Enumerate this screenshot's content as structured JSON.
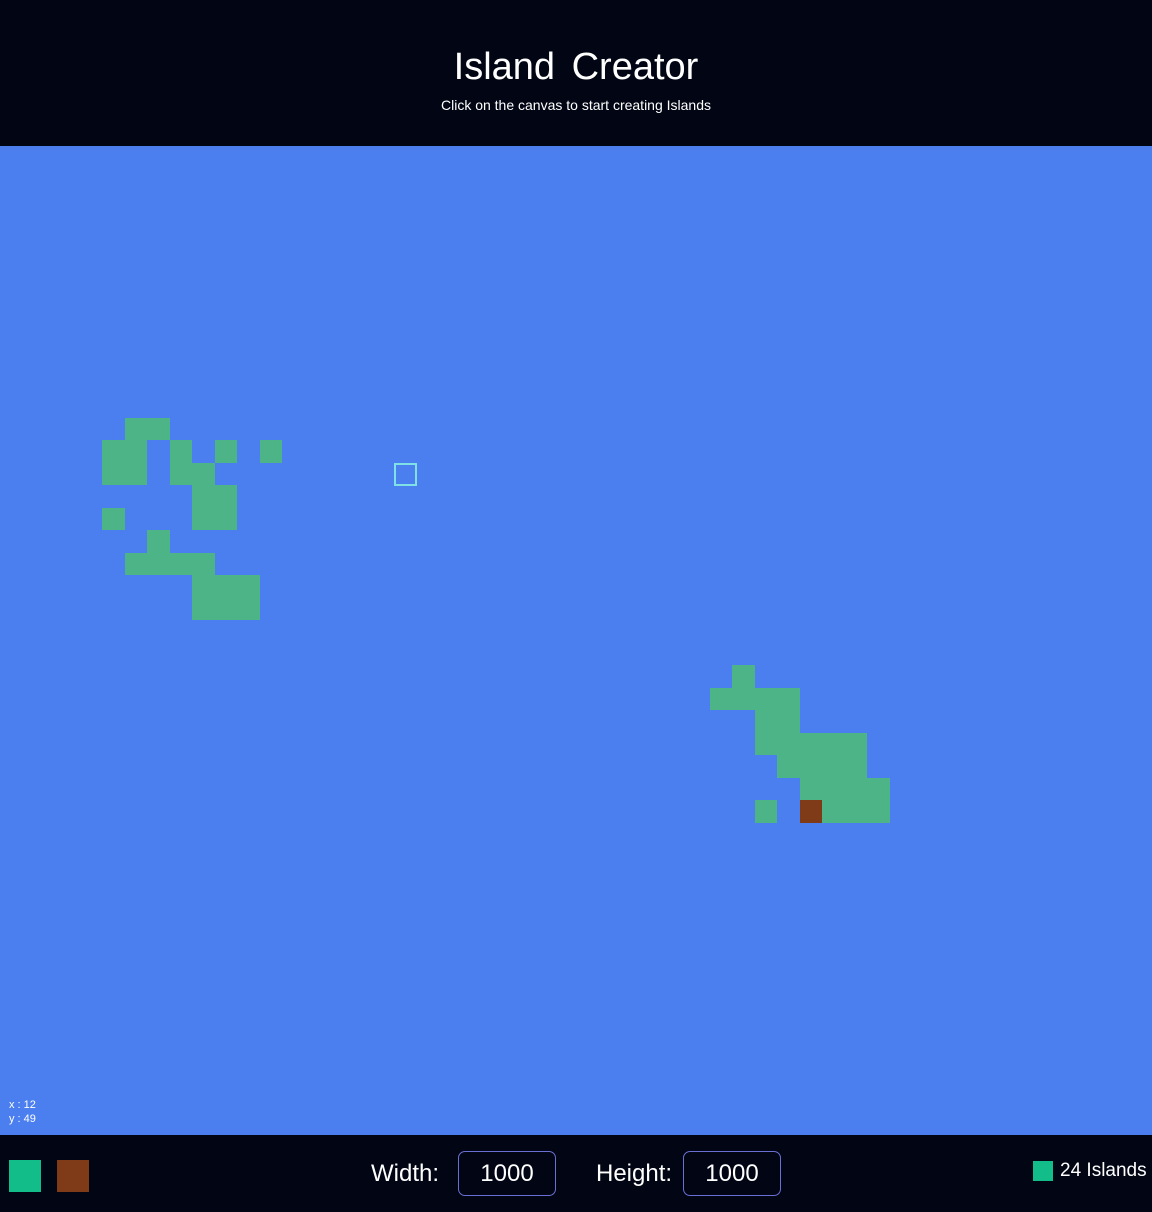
{
  "header": {
    "title": "Island  Creator",
    "subtitle": "Click on the canvas to start creating Islands"
  },
  "colors": {
    "background": "#010514",
    "water": "#4b7fef",
    "land": "#4db488",
    "dirt": "#7f3a17",
    "land_swatch": "#13bd8a",
    "hover_outline": "#7fe0e6",
    "input_border": "#6a6fd4"
  },
  "canvas": {
    "cell_size_units": 1,
    "land_cells": [
      [
        6,
        12
      ],
      [
        7,
        12
      ],
      [
        5,
        13
      ],
      [
        6,
        13
      ],
      [
        8,
        13
      ],
      [
        10,
        13
      ],
      [
        12,
        13
      ],
      [
        5,
        14
      ],
      [
        6,
        14
      ],
      [
        8,
        14
      ],
      [
        9,
        14
      ],
      [
        9,
        15
      ],
      [
        10,
        15
      ],
      [
        5,
        16
      ],
      [
        9,
        16
      ],
      [
        10,
        16
      ],
      [
        7,
        17
      ],
      [
        6,
        18
      ],
      [
        7,
        18
      ],
      [
        8,
        18
      ],
      [
        9,
        18
      ],
      [
        9,
        19
      ],
      [
        10,
        19
      ],
      [
        11,
        19
      ],
      [
        9,
        20
      ],
      [
        10,
        20
      ],
      [
        11,
        20
      ],
      [
        33,
        23
      ],
      [
        32,
        24
      ],
      [
        33,
        24
      ],
      [
        34,
        24
      ],
      [
        35,
        24
      ],
      [
        34,
        25
      ],
      [
        35,
        25
      ],
      [
        34,
        26
      ],
      [
        35,
        26
      ],
      [
        36,
        26
      ],
      [
        37,
        26
      ],
      [
        38,
        26
      ],
      [
        35,
        27
      ],
      [
        36,
        27
      ],
      [
        37,
        27
      ],
      [
        38,
        27
      ],
      [
        36,
        28
      ],
      [
        37,
        28
      ],
      [
        38,
        28
      ],
      [
        39,
        28
      ],
      [
        34,
        29
      ],
      [
        37,
        29
      ],
      [
        38,
        29
      ],
      [
        39,
        29
      ]
    ],
    "dirt_cells": [
      [
        36,
        29
      ]
    ],
    "hover_cell": [
      18,
      14
    ]
  },
  "coords": {
    "x_text": "x : 12",
    "y_text": "y : 49"
  },
  "footer": {
    "width_label": "Width:",
    "width_value": "1000",
    "height_label": "Height:",
    "height_value": "1000",
    "islands_count": "24 Islands"
  }
}
